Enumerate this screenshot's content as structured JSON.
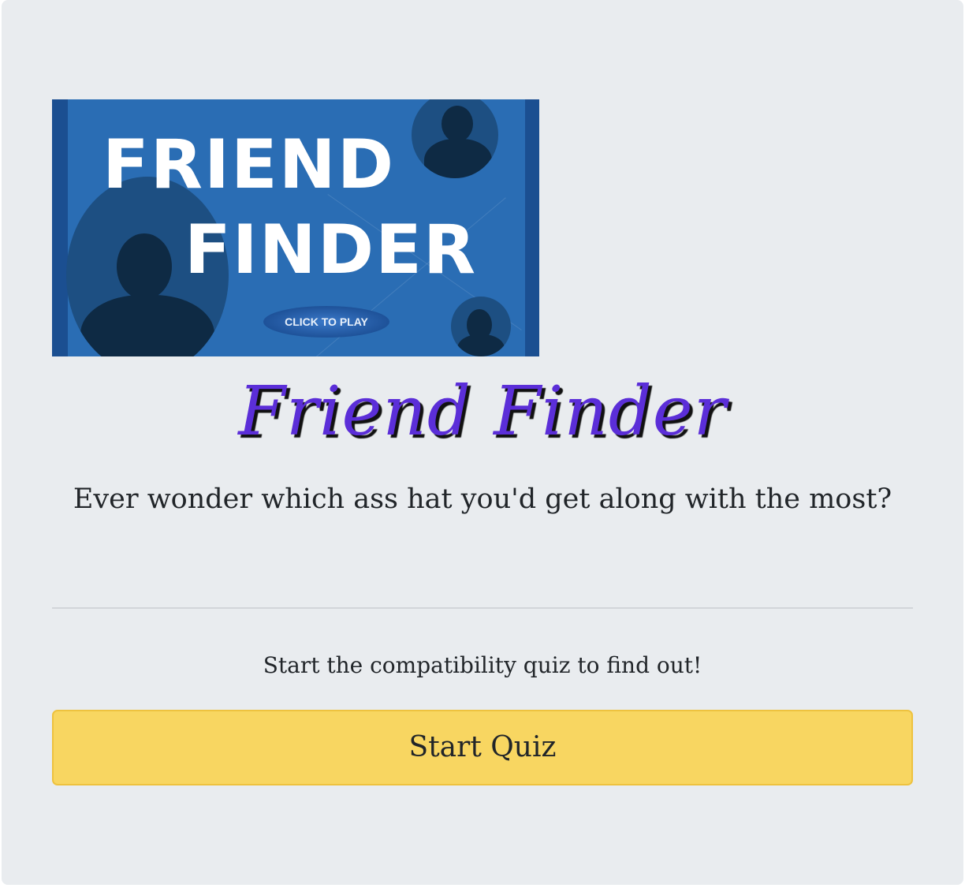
{
  "banner": {
    "line1": "FRIEND",
    "line2": "FINDER",
    "play_label": "CLICK TO PLAY"
  },
  "header": {
    "title": "Friend Finder",
    "lead": "Ever wonder which ass hat you'd get along with the most?"
  },
  "quiz": {
    "prompt": "Start the compatibility quiz to find out!",
    "start_label": "Start Quiz"
  },
  "colors": {
    "title": "#5b2ed8",
    "button": "#f8d661",
    "background": "#e9ecef"
  }
}
